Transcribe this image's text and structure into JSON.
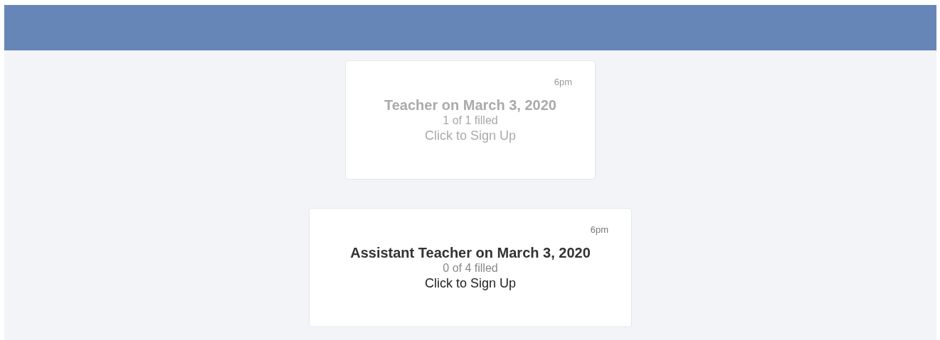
{
  "slots": [
    {
      "time": "6pm",
      "title": "Teacher on March 3, 2020",
      "filled": "1 of 1 filled",
      "action": "Click to Sign Up",
      "disabled": true
    },
    {
      "time": "6pm",
      "title": "Assistant Teacher on March 3, 2020",
      "filled": "0 of 4 filled",
      "action": "Click to Sign Up",
      "disabled": false
    }
  ]
}
